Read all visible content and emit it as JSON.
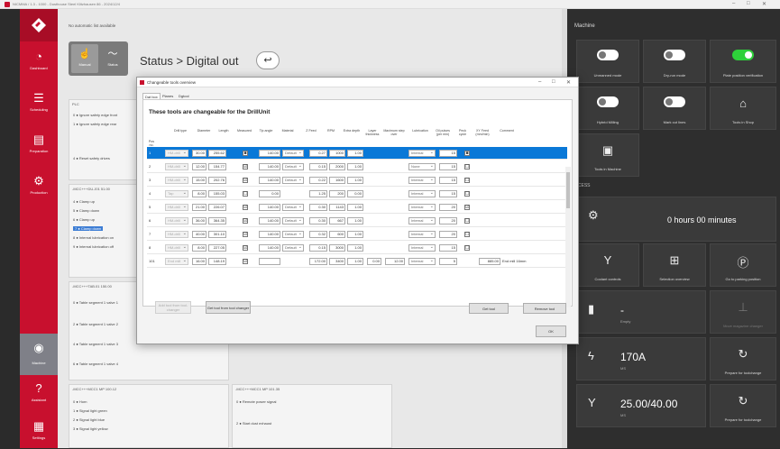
{
  "window": {
    "title": "NICMMA / 1.3 - 1000 - Dusthouse Steel Klitzhausen 86 - 2024/12/4"
  },
  "sidebar": {
    "items": [
      {
        "label": "Dashboard",
        "icon": "speedometer-icon"
      },
      {
        "label": "Scheduling",
        "icon": "list-icon"
      },
      {
        "label": "Preparation",
        "icon": "document-icon"
      },
      {
        "label": "Production",
        "icon": "gears-icon"
      },
      {
        "label": "Machine",
        "icon": "machine-icon"
      },
      {
        "label": "Assistant",
        "icon": "help-icon"
      },
      {
        "label": "Settings",
        "icon": "settings-icon"
      }
    ]
  },
  "main": {
    "notice": "No automatic list available",
    "mode_buttons": [
      {
        "label": "Manual"
      },
      {
        "label": "Status"
      }
    ],
    "breadcrumb": "Status > Digital out",
    "panels": [
      {
        "title": "PLC",
        "rows": [
          "0 ● Ignore safety edge front",
          "1 ● Ignore safety edge rear",
          "4 ● Reset safety drives"
        ]
      },
      {
        "title": "-MCC+++DU.J01 51.00",
        "rows": [
          "4 ● Clamp up",
          "5 ● Clamp down",
          "6 ● Clamp up",
          "7 ● Clamp down",
          "8 ● Internal lubrication on",
          "9 ● Internal lubrication off"
        ]
      },
      {
        "title": "-MCC+++TAB.01 150.00",
        "rows": [
          "0 ● Table segment 1 valve 1",
          "2 ● Table segment 1 valve 2",
          "4 ● Table segment 1 valve 3",
          "6 ● Table segment 1 valve 4"
        ]
      },
      {
        "title": "-MCC+++MCC1 MP 100.12",
        "rows": [
          "0 ● Horn",
          "1 ● Signal light green",
          "2 ● Signal light blue",
          "3 ● Signal light yellow"
        ]
      },
      {
        "title": "-MCC+++MCC1 MP 101.35",
        "rows": [
          "0 ● Remote power signal",
          "2 ● Start dust exhaust"
        ]
      }
    ]
  },
  "machine_panel": {
    "header": "Machine",
    "toggles": [
      {
        "label": "Unmanned mode",
        "on": false
      },
      {
        "label": "Dry-run mode",
        "on": false
      },
      {
        "label": "Plate position verification",
        "on": true
      },
      {
        "label": "Hybrid Milling",
        "on": false
      },
      {
        "label": "Mark cut lines",
        "on": false
      }
    ],
    "tiles": [
      {
        "label": "Tools in Shop",
        "icon": "tool-shop-icon"
      },
      {
        "label": "Tools in Machine",
        "icon": "tool-machine-icon"
      }
    ],
    "process_header": "OCESS",
    "runtime": "0 hours 00 minutes",
    "actions": [
      {
        "label": "Coolant controls",
        "icon": "coolant-icon"
      },
      {
        "label": "Selection overview",
        "icon": "selection-icon"
      },
      {
        "label": "Go to parking position",
        "icon": "parking-icon"
      },
      {
        "label": "Move magazine changer",
        "icon": "magazine-icon"
      },
      {
        "label": "Prepare for toolchange",
        "icon": "toolchange-icon"
      },
      {
        "label": "Prepare for toolchange",
        "icon": "toolchange-icon"
      }
    ],
    "status": [
      {
        "value": "-",
        "sub": "Empty",
        "icon": "spindle-icon"
      },
      {
        "value": "170A",
        "sub": "MS",
        "icon": "current-icon"
      },
      {
        "value": "25.00/40.00",
        "sub": "MS",
        "icon": "load-icon"
      }
    ]
  },
  "dialog": {
    "title": "Changeable tools overview",
    "tabs": [
      "Dat box",
      "Planes",
      "Dgtool"
    ],
    "heading": "These tools are changeable for the DrillUnit",
    "columns": [
      "Pos no.",
      "Drill type",
      "Diameter",
      "Length",
      "Measured",
      "Tip angle",
      "Material",
      "Z Feed",
      "RPM",
      "Extra depth",
      "Layer thickness",
      "Maximum step over",
      "Lubrication",
      "Oil pulses (per min)",
      "Peck cycle",
      "XY Feed (mm/min)",
      "Comment"
    ],
    "rows": [
      {
        "pos": "1",
        "type": "HM-drill",
        "dia": "30.00",
        "len": "255.62",
        "measured": "■",
        "tip": "140.00",
        "material": "Default",
        "zfeed": "0.27",
        "rpm": "1000",
        "extra": "1.00",
        "lubr": "Internal",
        "oil": "15",
        "peck": "■",
        "selected": true
      },
      {
        "pos": "2",
        "type": "HM-drill",
        "dia": "12.00",
        "len": "154.77",
        "measured": "☑",
        "tip": "140.00",
        "material": "Default",
        "zfeed": "0.15",
        "rpm": "2000",
        "extra": "1.00",
        "lubr": "None",
        "oil": "15",
        "peck": "☐",
        "selected": false
      },
      {
        "pos": "3",
        "type": "HM-drill",
        "dia": "15.00",
        "len": "202.76",
        "measured": "☑",
        "tip": "140.00",
        "material": "Default",
        "zfeed": "0.22",
        "rpm": "1600",
        "extra": "1.00",
        "lubr": "Internal",
        "oil": "15",
        "peck": "☐",
        "selected": false
      },
      {
        "pos": "4",
        "type": "Tap",
        "dia": "8.00",
        "len": "155.03",
        "measured": "☐",
        "tip": "0.00",
        "material": "",
        "zfeed": "1.25",
        "rpm": "200",
        "extra": "0.00",
        "lubr": "Internal",
        "oil": "15",
        "peck": "☐",
        "selected": false
      },
      {
        "pos": "5",
        "type": "HM-drill",
        "dia": "21.00",
        "len": "226.07",
        "measured": "☑",
        "tip": "140.00",
        "material": "Default",
        "zfeed": "0.30",
        "rpm": "1143",
        "extra": "1.00",
        "lubr": "Internal",
        "oil": "20",
        "peck": "☑",
        "selected": false
      },
      {
        "pos": "6",
        "type": "HM-drill",
        "dia": "36.00",
        "len": "364.35",
        "measured": "☑",
        "tip": "140.00",
        "material": "Default",
        "zfeed": "0.30",
        "rpm": "667",
        "extra": "1.00",
        "lubr": "Internal",
        "oil": "20",
        "peck": "☐",
        "selected": false
      },
      {
        "pos": "7",
        "type": "HM-drill",
        "dia": "40.00",
        "len": "301.10",
        "measured": "☑",
        "tip": "140.00",
        "material": "Default",
        "zfeed": "0.32",
        "rpm": "600",
        "extra": "1.00",
        "lubr": "Internal",
        "oil": "20",
        "peck": "☐",
        "selected": false
      },
      {
        "pos": "8",
        "type": "HM-drill",
        "dia": "8.00",
        "len": "227.05",
        "measured": "☑",
        "tip": "140.00",
        "material": "Default",
        "zfeed": "0.15",
        "rpm": "3000",
        "extra": "1.00",
        "lubr": "Internal",
        "oil": "15",
        "peck": "☐",
        "selected": false
      },
      {
        "pos": "101",
        "type": "End mill",
        "dia": "16.00",
        "len": "148.19",
        "measured": "☑",
        "tip": "",
        "material": "",
        "zfeed": "172.00",
        "rpm": "3400",
        "extra": "1.00",
        "layer": "0.00",
        "step": "12.00",
        "lubr": "Internal",
        "oil": "5",
        "peck": "",
        "xyfeed": "885.00",
        "comment": "End mill 16mm",
        "selected": false
      }
    ],
    "buttons": {
      "add_tool": "Add tool from tool-changer",
      "get_tool": "Get tool from tool changer",
      "get": "Get tool",
      "remove": "Remove tool",
      "ok": "OK"
    }
  }
}
